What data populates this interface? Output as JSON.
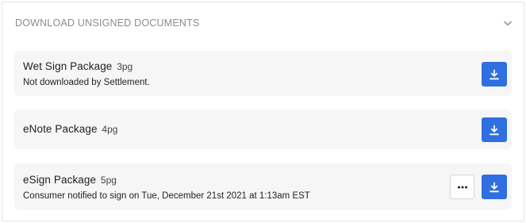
{
  "panel": {
    "title": "DOWNLOAD UNSIGNED DOCUMENTS"
  },
  "documents": [
    {
      "name": "Wet Sign Package",
      "pages": "3pg",
      "status": "Not downloaded by Settlement."
    },
    {
      "name": "eNote Package",
      "pages": "4pg"
    },
    {
      "name": "eSign Package",
      "pages": "5pg",
      "status": "Consumer notified to sign on Tue, December 21st 2021 at 1:13am EST"
    }
  ],
  "colors": {
    "accent": "#2f6fe0",
    "row_bg": "#f6f6f6",
    "title": "#8c8c8c"
  },
  "icons": {
    "collapse": "chevron-down-icon",
    "download": "download-icon",
    "more": "more-horizontal-icon"
  }
}
